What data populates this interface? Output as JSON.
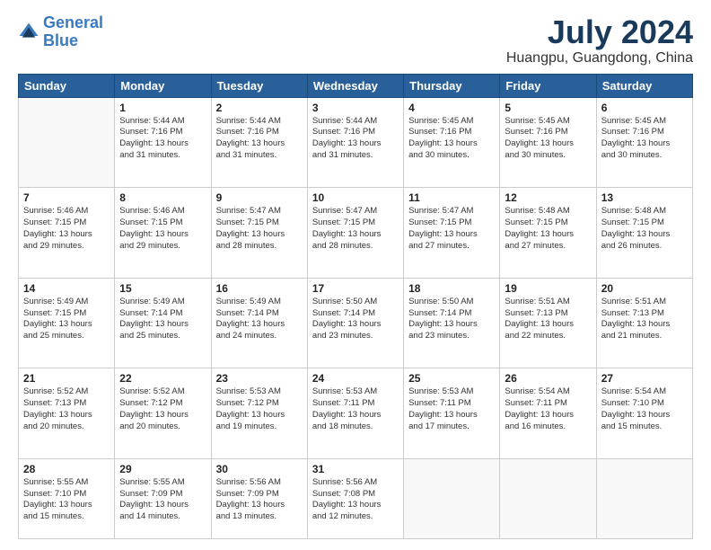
{
  "logo": {
    "line1": "General",
    "line2": "Blue"
  },
  "title": "July 2024",
  "subtitle": "Huangpu, Guangdong, China",
  "days_of_week": [
    "Sunday",
    "Monday",
    "Tuesday",
    "Wednesday",
    "Thursday",
    "Friday",
    "Saturday"
  ],
  "weeks": [
    [
      {
        "day": "",
        "info": ""
      },
      {
        "day": "1",
        "info": "Sunrise: 5:44 AM\nSunset: 7:16 PM\nDaylight: 13 hours\nand 31 minutes."
      },
      {
        "day": "2",
        "info": "Sunrise: 5:44 AM\nSunset: 7:16 PM\nDaylight: 13 hours\nand 31 minutes."
      },
      {
        "day": "3",
        "info": "Sunrise: 5:44 AM\nSunset: 7:16 PM\nDaylight: 13 hours\nand 31 minutes."
      },
      {
        "day": "4",
        "info": "Sunrise: 5:45 AM\nSunset: 7:16 PM\nDaylight: 13 hours\nand 30 minutes."
      },
      {
        "day": "5",
        "info": "Sunrise: 5:45 AM\nSunset: 7:16 PM\nDaylight: 13 hours\nand 30 minutes."
      },
      {
        "day": "6",
        "info": "Sunrise: 5:45 AM\nSunset: 7:16 PM\nDaylight: 13 hours\nand 30 minutes."
      }
    ],
    [
      {
        "day": "7",
        "info": "Sunrise: 5:46 AM\nSunset: 7:15 PM\nDaylight: 13 hours\nand 29 minutes."
      },
      {
        "day": "8",
        "info": "Sunrise: 5:46 AM\nSunset: 7:15 PM\nDaylight: 13 hours\nand 29 minutes."
      },
      {
        "day": "9",
        "info": "Sunrise: 5:47 AM\nSunset: 7:15 PM\nDaylight: 13 hours\nand 28 minutes."
      },
      {
        "day": "10",
        "info": "Sunrise: 5:47 AM\nSunset: 7:15 PM\nDaylight: 13 hours\nand 28 minutes."
      },
      {
        "day": "11",
        "info": "Sunrise: 5:47 AM\nSunset: 7:15 PM\nDaylight: 13 hours\nand 27 minutes."
      },
      {
        "day": "12",
        "info": "Sunrise: 5:48 AM\nSunset: 7:15 PM\nDaylight: 13 hours\nand 27 minutes."
      },
      {
        "day": "13",
        "info": "Sunrise: 5:48 AM\nSunset: 7:15 PM\nDaylight: 13 hours\nand 26 minutes."
      }
    ],
    [
      {
        "day": "14",
        "info": "Sunrise: 5:49 AM\nSunset: 7:15 PM\nDaylight: 13 hours\nand 25 minutes."
      },
      {
        "day": "15",
        "info": "Sunrise: 5:49 AM\nSunset: 7:14 PM\nDaylight: 13 hours\nand 25 minutes."
      },
      {
        "day": "16",
        "info": "Sunrise: 5:49 AM\nSunset: 7:14 PM\nDaylight: 13 hours\nand 24 minutes."
      },
      {
        "day": "17",
        "info": "Sunrise: 5:50 AM\nSunset: 7:14 PM\nDaylight: 13 hours\nand 23 minutes."
      },
      {
        "day": "18",
        "info": "Sunrise: 5:50 AM\nSunset: 7:14 PM\nDaylight: 13 hours\nand 23 minutes."
      },
      {
        "day": "19",
        "info": "Sunrise: 5:51 AM\nSunset: 7:13 PM\nDaylight: 13 hours\nand 22 minutes."
      },
      {
        "day": "20",
        "info": "Sunrise: 5:51 AM\nSunset: 7:13 PM\nDaylight: 13 hours\nand 21 minutes."
      }
    ],
    [
      {
        "day": "21",
        "info": "Sunrise: 5:52 AM\nSunset: 7:13 PM\nDaylight: 13 hours\nand 20 minutes."
      },
      {
        "day": "22",
        "info": "Sunrise: 5:52 AM\nSunset: 7:12 PM\nDaylight: 13 hours\nand 20 minutes."
      },
      {
        "day": "23",
        "info": "Sunrise: 5:53 AM\nSunset: 7:12 PM\nDaylight: 13 hours\nand 19 minutes."
      },
      {
        "day": "24",
        "info": "Sunrise: 5:53 AM\nSunset: 7:11 PM\nDaylight: 13 hours\nand 18 minutes."
      },
      {
        "day": "25",
        "info": "Sunrise: 5:53 AM\nSunset: 7:11 PM\nDaylight: 13 hours\nand 17 minutes."
      },
      {
        "day": "26",
        "info": "Sunrise: 5:54 AM\nSunset: 7:11 PM\nDaylight: 13 hours\nand 16 minutes."
      },
      {
        "day": "27",
        "info": "Sunrise: 5:54 AM\nSunset: 7:10 PM\nDaylight: 13 hours\nand 15 minutes."
      }
    ],
    [
      {
        "day": "28",
        "info": "Sunrise: 5:55 AM\nSunset: 7:10 PM\nDaylight: 13 hours\nand 15 minutes."
      },
      {
        "day": "29",
        "info": "Sunrise: 5:55 AM\nSunset: 7:09 PM\nDaylight: 13 hours\nand 14 minutes."
      },
      {
        "day": "30",
        "info": "Sunrise: 5:56 AM\nSunset: 7:09 PM\nDaylight: 13 hours\nand 13 minutes."
      },
      {
        "day": "31",
        "info": "Sunrise: 5:56 AM\nSunset: 7:08 PM\nDaylight: 13 hours\nand 12 minutes."
      },
      {
        "day": "",
        "info": ""
      },
      {
        "day": "",
        "info": ""
      },
      {
        "day": "",
        "info": ""
      }
    ]
  ]
}
